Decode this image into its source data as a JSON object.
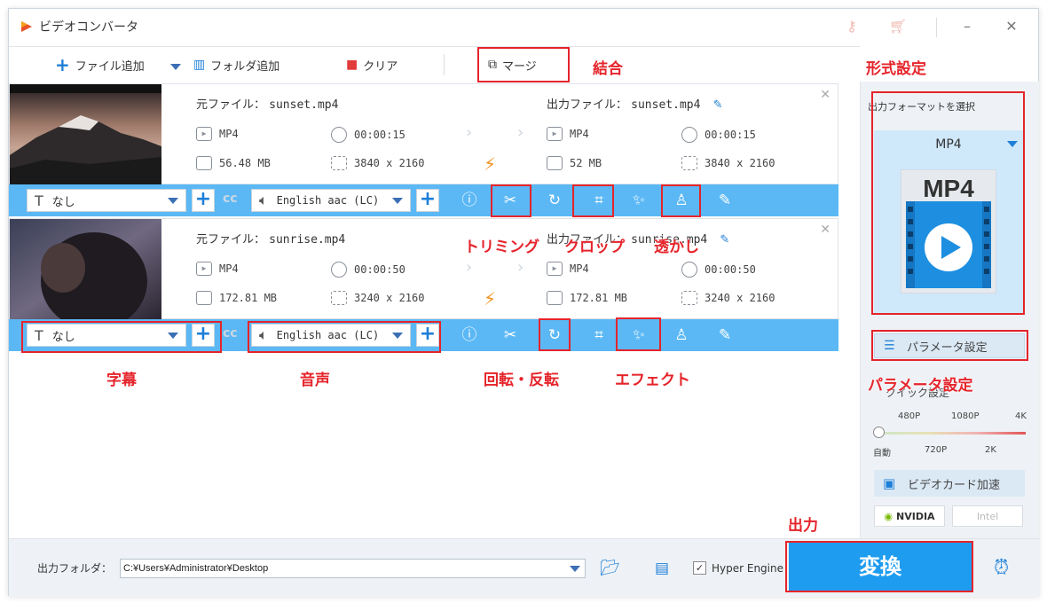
{
  "window": {
    "title": "ビデオコンバータ"
  },
  "toolbar": {
    "add_file": "ファイル追加",
    "add_folder": "フォルダ追加",
    "clear": "クリア",
    "merge": "マージ"
  },
  "files": [
    {
      "source_label": "元ファイル：",
      "source_name": "sunset.mp4",
      "output_label": "出力ファイル：",
      "output_name": "sunset.mp4",
      "src_format": "MP4",
      "src_duration": "00:00:15",
      "src_size": "56.48 MB",
      "src_resolution": "3840 x 2160",
      "out_format": "MP4",
      "out_duration": "00:00:15",
      "out_size": "52 MB",
      "out_resolution": "3840 x 2160",
      "subtitle": "なし",
      "audio": "English aac (LC)"
    },
    {
      "source_label": "元ファイル：",
      "source_name": "sunrise.mp4",
      "output_label": "出力ファイル：",
      "output_name": "sunrise.mp4",
      "src_format": "MP4",
      "src_duration": "00:00:50",
      "src_size": "172.81 MB",
      "src_resolution": "3240 x 2160",
      "out_format": "MP4",
      "out_duration": "00:00:50",
      "out_size": "172.81 MB",
      "out_resolution": "3240 x 2160",
      "subtitle": "なし",
      "audio": "English aac (LC)"
    }
  ],
  "right_panel": {
    "format_label": "出力フォーマットを選択",
    "format_name": "MP4",
    "format_icon_text": "MP4",
    "param_button": "パラメータ設定",
    "quality_label": "クイック設定",
    "quality_ticks_top": [
      "480P",
      "1080P",
      "4K"
    ],
    "quality_ticks_bottom": [
      "自動",
      "720P",
      "2K"
    ],
    "gpu_button": "ビデオカード加速",
    "vendors": [
      "NVIDIA",
      "Intel"
    ]
  },
  "bottom": {
    "output_folder_label": "出力フォルダ：",
    "output_path": "C:¥Users¥Administrator¥Desktop",
    "hyper_engine": "Hyper Engine",
    "hyper_checked": "✓",
    "convert": "変換"
  },
  "annotations": {
    "merge": "結合",
    "format_settings": "形式設定",
    "trim": "トリミング",
    "crop": "クロップ",
    "watermark": "透かし",
    "subtitle": "字幕",
    "audio": "音声",
    "rotate": "回転・反転",
    "effect": "エフェクト",
    "param_settings": "パラメータ設定",
    "output": "出力"
  },
  "colors": {
    "accent": "#1e9cf0",
    "ctrlbar": "#5bb8f5",
    "annotation": "#e5242b",
    "bolt": "#f2921e"
  }
}
